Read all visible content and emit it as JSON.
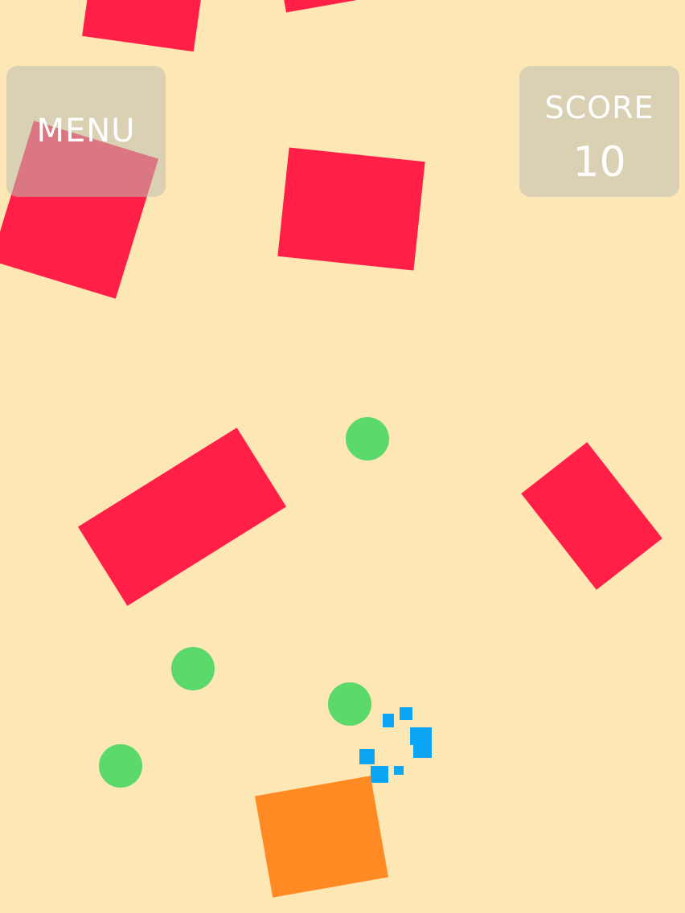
{
  "hud": {
    "menu_label": "MENU",
    "score_label": "SCORE",
    "score_value": "10"
  },
  "colors": {
    "background": "#fde7b4",
    "obstacle": "#ff1f47",
    "orb": "#5bd96a",
    "player": "#ff8a24",
    "particle": "#0aa6f5"
  },
  "icons": {
    "obstacle": "red-block",
    "orb": "green-orb",
    "player": "orange-block",
    "particle": "blue-particle"
  }
}
